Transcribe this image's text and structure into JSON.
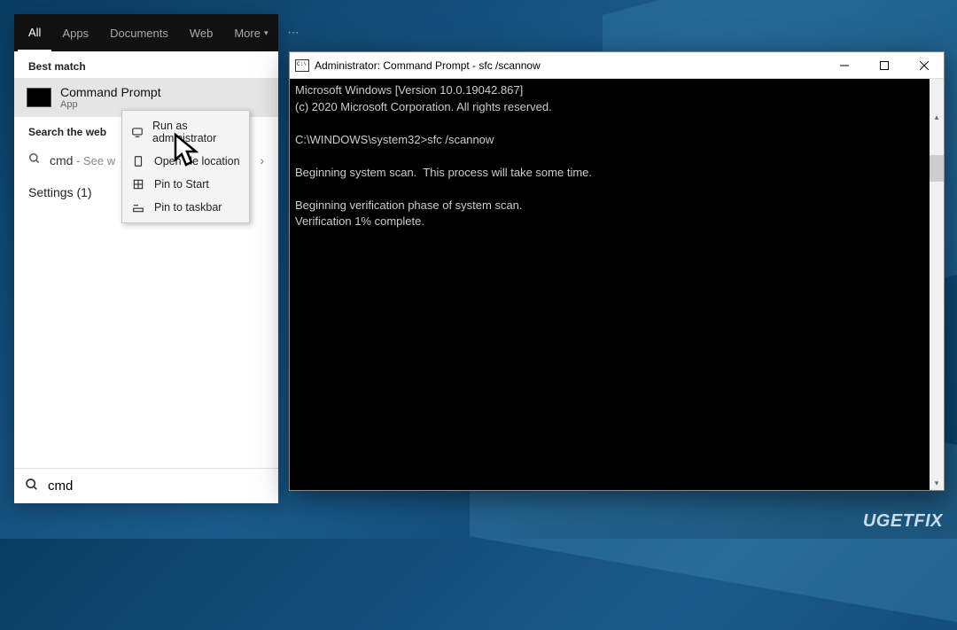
{
  "start_panel": {
    "tabs": [
      "All",
      "Apps",
      "Documents",
      "Web",
      "More"
    ],
    "active_tab_index": 0,
    "best_match_label": "Best match",
    "result": {
      "title": "Command Prompt",
      "subtitle": "App"
    },
    "search_web_label": "Search the web",
    "web_item": {
      "term": "cmd",
      "suffix": " - See w"
    },
    "settings_label": "Settings (1)",
    "search_value": "cmd"
  },
  "context_menu": {
    "items": [
      {
        "icon": "admin",
        "label": "Run as administrator"
      },
      {
        "icon": "folder",
        "label": "Open file location"
      },
      {
        "icon": "pin-start",
        "label": "Pin to Start"
      },
      {
        "icon": "pin-taskbar",
        "label": "Pin to taskbar"
      }
    ]
  },
  "cmd_window": {
    "title": "Administrator: Command Prompt - sfc  /scannow",
    "lines": [
      "Microsoft Windows [Version 10.0.19042.867]",
      "(c) 2020 Microsoft Corporation. All rights reserved.",
      "",
      "C:\\WINDOWS\\system32>sfc /scannow",
      "",
      "Beginning system scan.  This process will take some time.",
      "",
      "Beginning verification phase of system scan.",
      "Verification 1% complete."
    ]
  },
  "watermark": "UGETFIX"
}
